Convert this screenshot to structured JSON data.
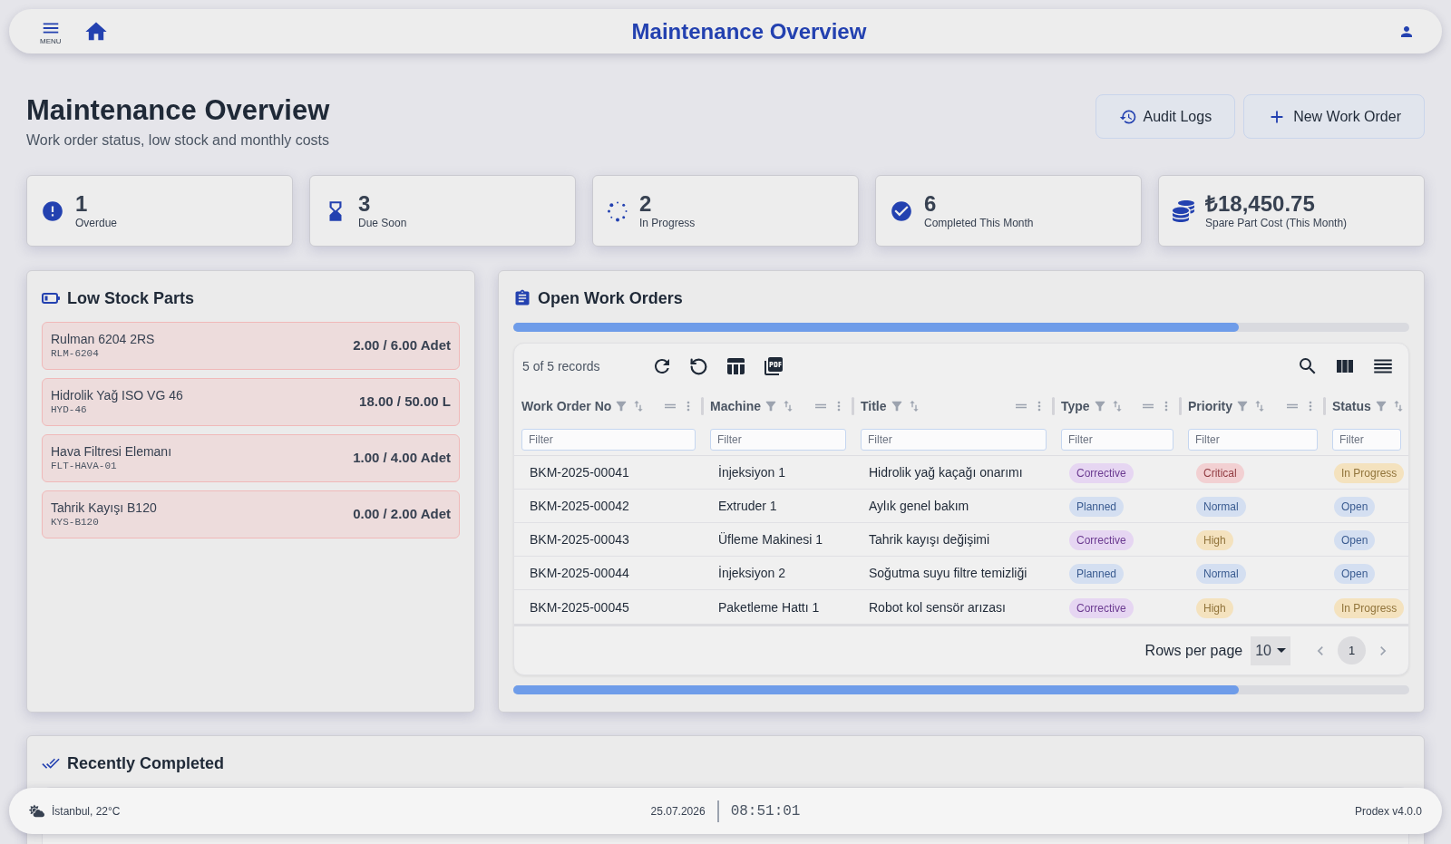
{
  "app_bar": {
    "menu_label": "MENU",
    "title": "Maintenance Overview"
  },
  "header": {
    "title": "Maintenance Overview",
    "subtitle": "Work order status, low stock and monthly costs",
    "buttons": [
      {
        "kind": "history",
        "label": "Audit Logs"
      },
      {
        "kind": "add",
        "label": "New Work Order"
      }
    ]
  },
  "stats": [
    {
      "kind": "overdue",
      "value": "1",
      "label": "Overdue"
    },
    {
      "kind": "due_soon",
      "value": "3",
      "label": "Due Soon"
    },
    {
      "kind": "in_progress",
      "value": "2",
      "label": "In Progress"
    },
    {
      "kind": "completed",
      "value": "6",
      "label": "Completed This Month"
    },
    {
      "kind": "cost",
      "value": "₺18,450.75",
      "label": "Spare Part Cost (This Month)"
    }
  ],
  "low_stock": {
    "title": "Low Stock Parts",
    "items": [
      {
        "name": "Rulman 6204 2RS",
        "code": "RLM-6204",
        "quantity": "2.00 / 6.00 Adet"
      },
      {
        "name": "Hidrolik Yağ ISO VG 46",
        "code": "HYD-46",
        "quantity": "18.00 / 50.00 L"
      },
      {
        "name": "Hava Filtresi Elemanı",
        "code": "FLT-HAVA-01",
        "quantity": "1.00 / 4.00 Adet"
      },
      {
        "name": "Tahrik Kayışı B120",
        "code": "KYS-B120",
        "quantity": "0.00 / 2.00 Adet"
      }
    ]
  },
  "work_orders": {
    "title": "Open Work Orders",
    "record_count": "5 of 5 records",
    "columns": [
      {
        "label": "Work Order No",
        "kind": "text",
        "filter_placeholder": "Filter"
      },
      {
        "label": "Machine",
        "kind": "text",
        "filter_placeholder": "Filter"
      },
      {
        "label": "Title",
        "kind": "text",
        "filter_placeholder": "Filter"
      },
      {
        "label": "Type",
        "kind": "badge",
        "filter_placeholder": "Filter"
      },
      {
        "label": "Priority",
        "kind": "badge",
        "filter_placeholder": "Filter"
      },
      {
        "label": "Status",
        "kind": "badge",
        "filter_placeholder": "Filter"
      }
    ],
    "rows": [
      {
        "cells": [
          {
            "text": "BKM-2025-00041"
          },
          {
            "text": "İnjeksiyon 1"
          },
          {
            "text": "Hidrolik yağ kaçağı onarımı"
          },
          {
            "text": "Corrective",
            "color": "#e6d6f2"
          },
          {
            "text": "Critical",
            "color": "#f2d0d2"
          },
          {
            "text": "In Progress",
            "color": "#f4e2be"
          }
        ]
      },
      {
        "cells": [
          {
            "text": "BKM-2025-00042"
          },
          {
            "text": "Extruder 1"
          },
          {
            "text": "Aylık genel bakım"
          },
          {
            "text": "Planned",
            "color": "#d4dff1"
          },
          {
            "text": "Normal",
            "color": "#d4dff1"
          },
          {
            "text": "Open",
            "color": "#d4dff1"
          }
        ]
      },
      {
        "cells": [
          {
            "text": "BKM-2025-00043"
          },
          {
            "text": "Üfleme Makinesi 1"
          },
          {
            "text": "Tahrik kayışı değişimi"
          },
          {
            "text": "Corrective",
            "color": "#e6d6f2"
          },
          {
            "text": "High",
            "color": "#f4e2be"
          },
          {
            "text": "Open",
            "color": "#d4dff1"
          }
        ]
      },
      {
        "cells": [
          {
            "text": "BKM-2025-00044"
          },
          {
            "text": "İnjeksiyon 2"
          },
          {
            "text": "Soğutma suyu filtre temizliği"
          },
          {
            "text": "Planned",
            "color": "#d4dff1"
          },
          {
            "text": "Normal",
            "color": "#d4dff1"
          },
          {
            "text": "Open",
            "color": "#d4dff1"
          }
        ]
      },
      {
        "cells": [
          {
            "text": "BKM-2025-00045"
          },
          {
            "text": "Paketleme Hattı 1"
          },
          {
            "text": "Robot kol sensör arızası"
          },
          {
            "text": "Corrective",
            "color": "#e6d6f2"
          },
          {
            "text": "High",
            "color": "#f4e2be"
          },
          {
            "text": "In Progress",
            "color": "#f4e2be"
          }
        ]
      }
    ],
    "rows_per_page": {
      "label": "Rows per page",
      "value": "10"
    },
    "pages": [
      {
        "label": "1",
        "selected": true
      }
    ]
  },
  "recently_completed": {
    "title": "Recently Completed"
  },
  "status_bar": {
    "weather": "İstanbul, 22°C",
    "date": "25.07.2026",
    "time": "08:51:01",
    "version": "Prodex v4.0.0"
  }
}
